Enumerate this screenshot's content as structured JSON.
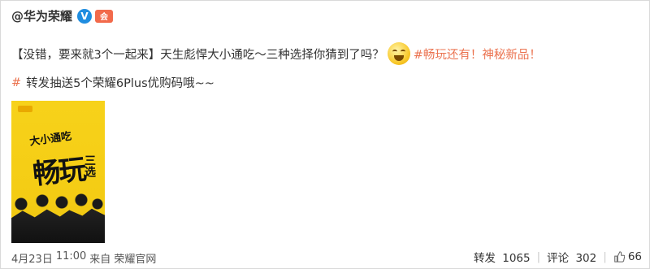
{
  "post": {
    "author": {
      "name": "@华为荣耀",
      "verified_badge": "V",
      "member_badge": "会"
    },
    "text_line1": {
      "part1": "【没错，要来就3个一起来】天生彪悍大小通吃～三种选择你猜到了吗？",
      "emoji": "grin-emoji",
      "hashtag": "#畅玩还有！神秘新品！"
    },
    "text_line2": {
      "hash": "#",
      "text": "转发抽送5个荣耀6Plus优购码哦~~"
    },
    "image": {
      "subtitle": "大小通吃",
      "big_title": "畅玩",
      "side_title": "三选"
    },
    "footer": {
      "date": "4月23日",
      "time": "11:00",
      "source_prefix": "来自",
      "source": "荣耀官网",
      "repost_label": "转发",
      "repost_count": "1065",
      "comment_label": "评论",
      "comment_count": "302",
      "like_count": "66"
    }
  },
  "colors": {
    "hashtag": "#eb7350",
    "verified": "#1f8de0",
    "poster_bg": "#f4cc14"
  }
}
